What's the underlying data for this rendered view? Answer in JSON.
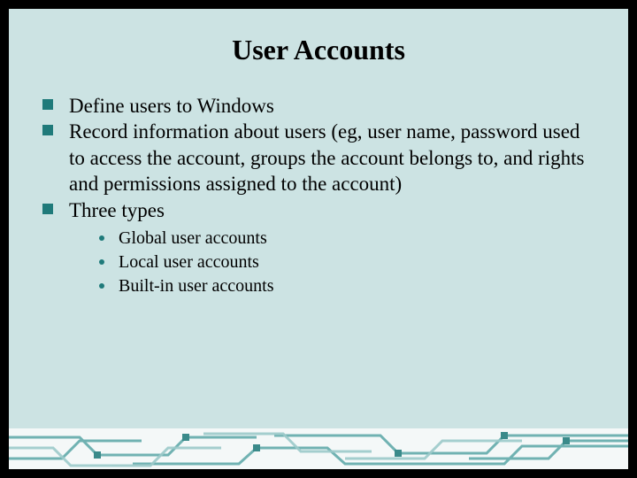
{
  "slide": {
    "title": "User Accounts",
    "bullets": [
      {
        "text": "Define users to Windows"
      },
      {
        "text": "Record information about users (eg, user name, password used to access the account, groups the account belongs to, and rights and permissions assigned to the account)"
      },
      {
        "text": "Three types",
        "sub": [
          "Global user accounts",
          "Local user accounts",
          "Built-in user accounts"
        ]
      }
    ]
  },
  "colors": {
    "accent": "#1f7a7a",
    "bg": "#cce3e3"
  }
}
